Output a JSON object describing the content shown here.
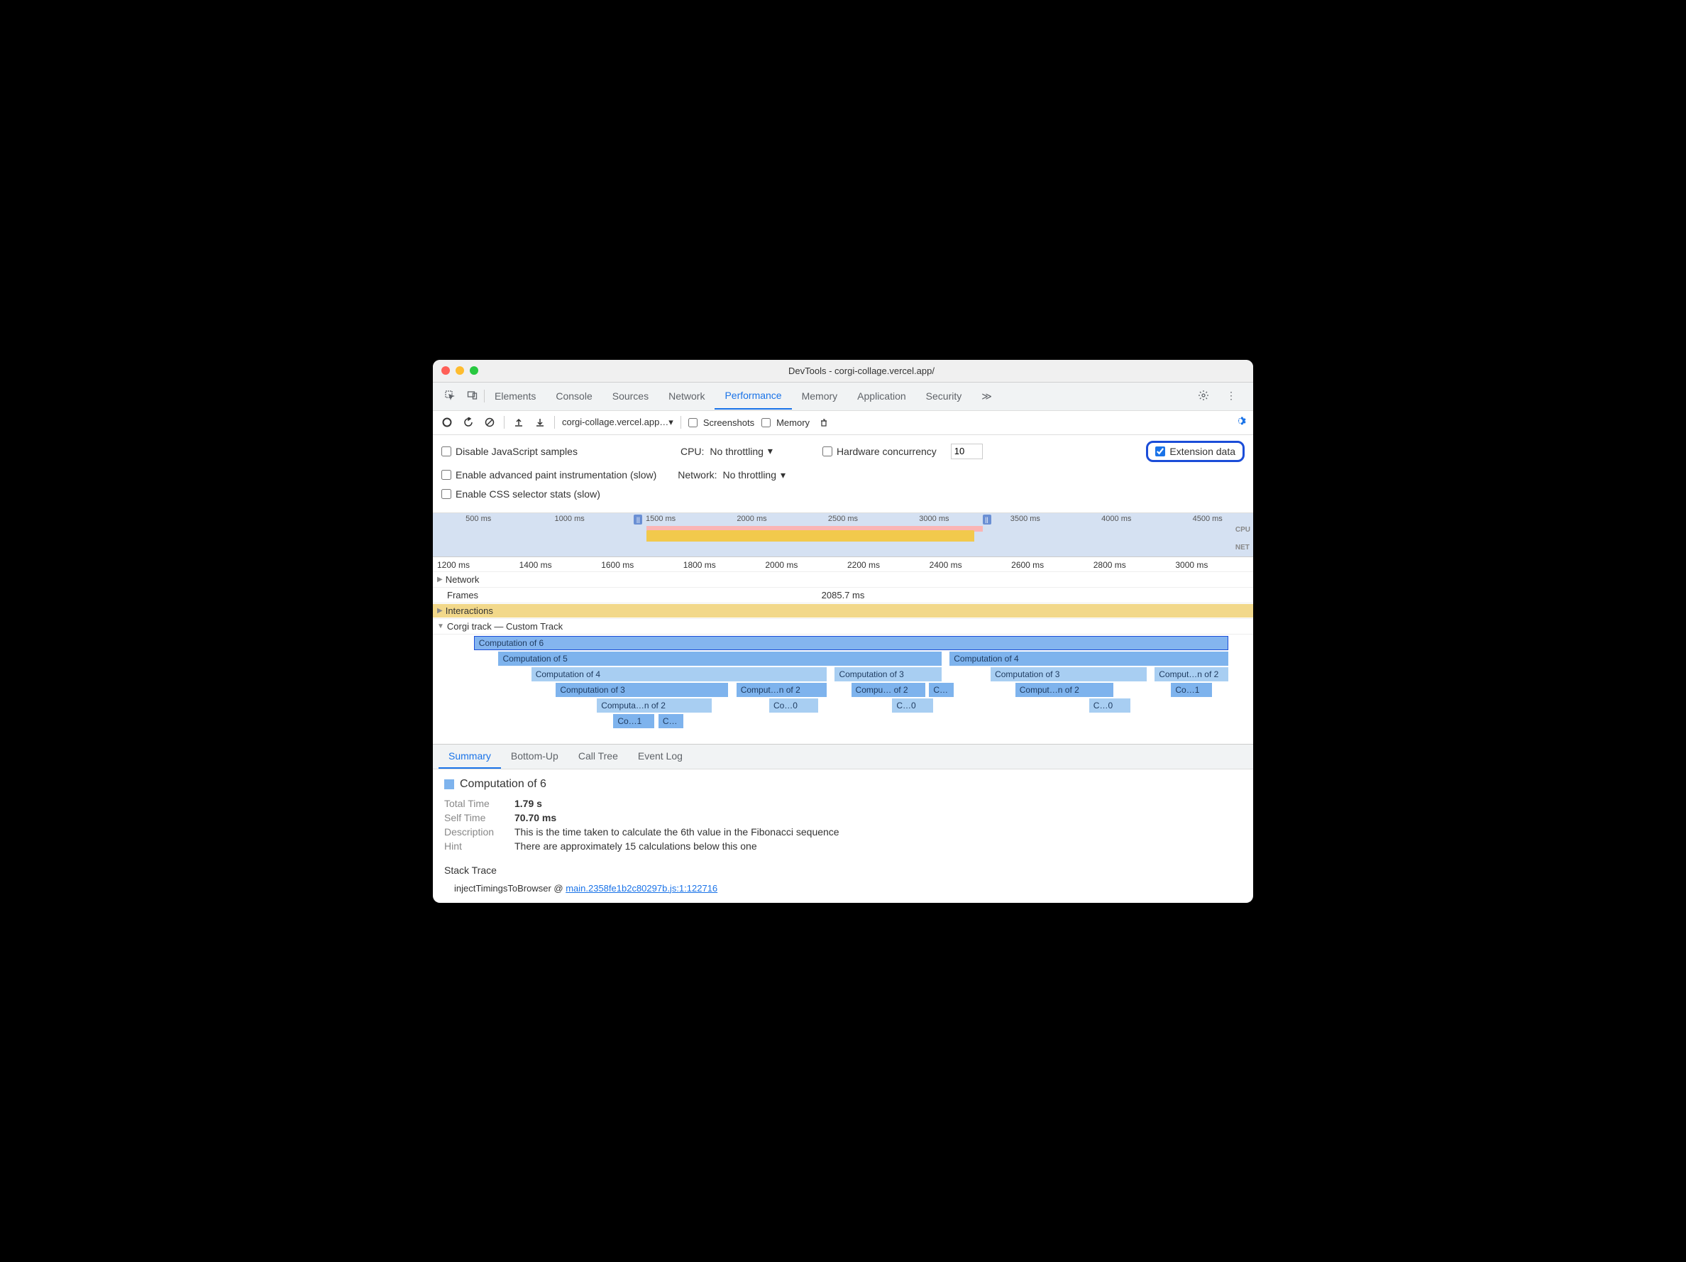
{
  "window": {
    "title": "DevTools - corgi-collage.vercel.app/"
  },
  "main_tabs": [
    "Elements",
    "Console",
    "Sources",
    "Network",
    "Performance",
    "Memory",
    "Application",
    "Security"
  ],
  "active_main_tab": "Performance",
  "toolbar": {
    "url": "corgi-collage.vercel.app…▾",
    "screenshots": "Screenshots",
    "memory": "Memory"
  },
  "settings": {
    "disable_js": "Disable JavaScript samples",
    "cpu_label": "CPU:",
    "cpu_value": "No throttling",
    "hw_label": "Hardware concurrency",
    "hw_value": "10",
    "ext_label": "Extension data",
    "paint": "Enable advanced paint instrumentation (slow)",
    "net_label": "Network:",
    "net_value": "No throttling",
    "css_stats": "Enable CSS selector stats (slow)"
  },
  "overview": {
    "ticks": [
      "500 ms",
      "1000 ms",
      "1500 ms",
      "2000 ms",
      "2500 ms",
      "3000 ms",
      "3500 ms",
      "4000 ms",
      "4500 ms"
    ],
    "cpu": "CPU",
    "net": "NET"
  },
  "ruler": [
    "1200 ms",
    "1400 ms",
    "1600 ms",
    "1800 ms",
    "2000 ms",
    "2200 ms",
    "2400 ms",
    "2600 ms",
    "2800 ms",
    "3000 ms"
  ],
  "tracks": {
    "network": "Network",
    "frames": "Frames",
    "frames_val": "2085.7 ms",
    "interactions": "Interactions",
    "corgi": "Corgi track — Custom Track"
  },
  "flame": {
    "r0": "Computation of 6",
    "r1a": "Computation of 5",
    "r1b": "Computation of 4",
    "r2a": "Computation of 4",
    "r2b": "Computation of 3",
    "r2c": "Computation of 3",
    "r2d": "Comput…n of 2",
    "r3a": "Computation of 3",
    "r3b": "Comput…n of 2",
    "r3c": "Compu… of 2",
    "r3d": "C…",
    "r3e": "Comput…n of 2",
    "r3f": "Co…1",
    "r4a": "Computa…n of 2",
    "r4b": "Co…0",
    "r4c": "C…0",
    "r4d": "C…0",
    "r5a": "Co…1",
    "r5b": "C…"
  },
  "detail_tabs": [
    "Summary",
    "Bottom-Up",
    "Call Tree",
    "Event Log"
  ],
  "summary": {
    "title": "Computation of 6",
    "total_l": "Total Time",
    "total_v": "1.79 s",
    "self_l": "Self Time",
    "self_v": "70.70 ms",
    "desc_l": "Description",
    "desc_v": "This is the time taken to calculate the 6th value in the Fibonacci sequence",
    "hint_l": "Hint",
    "hint_v": "There are approximately 15 calculations below this one",
    "stack_title": "Stack Trace",
    "stack_fn": "injectTimingsToBrowser @ ",
    "stack_link": "main.2358fe1b2c80297b.js:1:122716"
  }
}
